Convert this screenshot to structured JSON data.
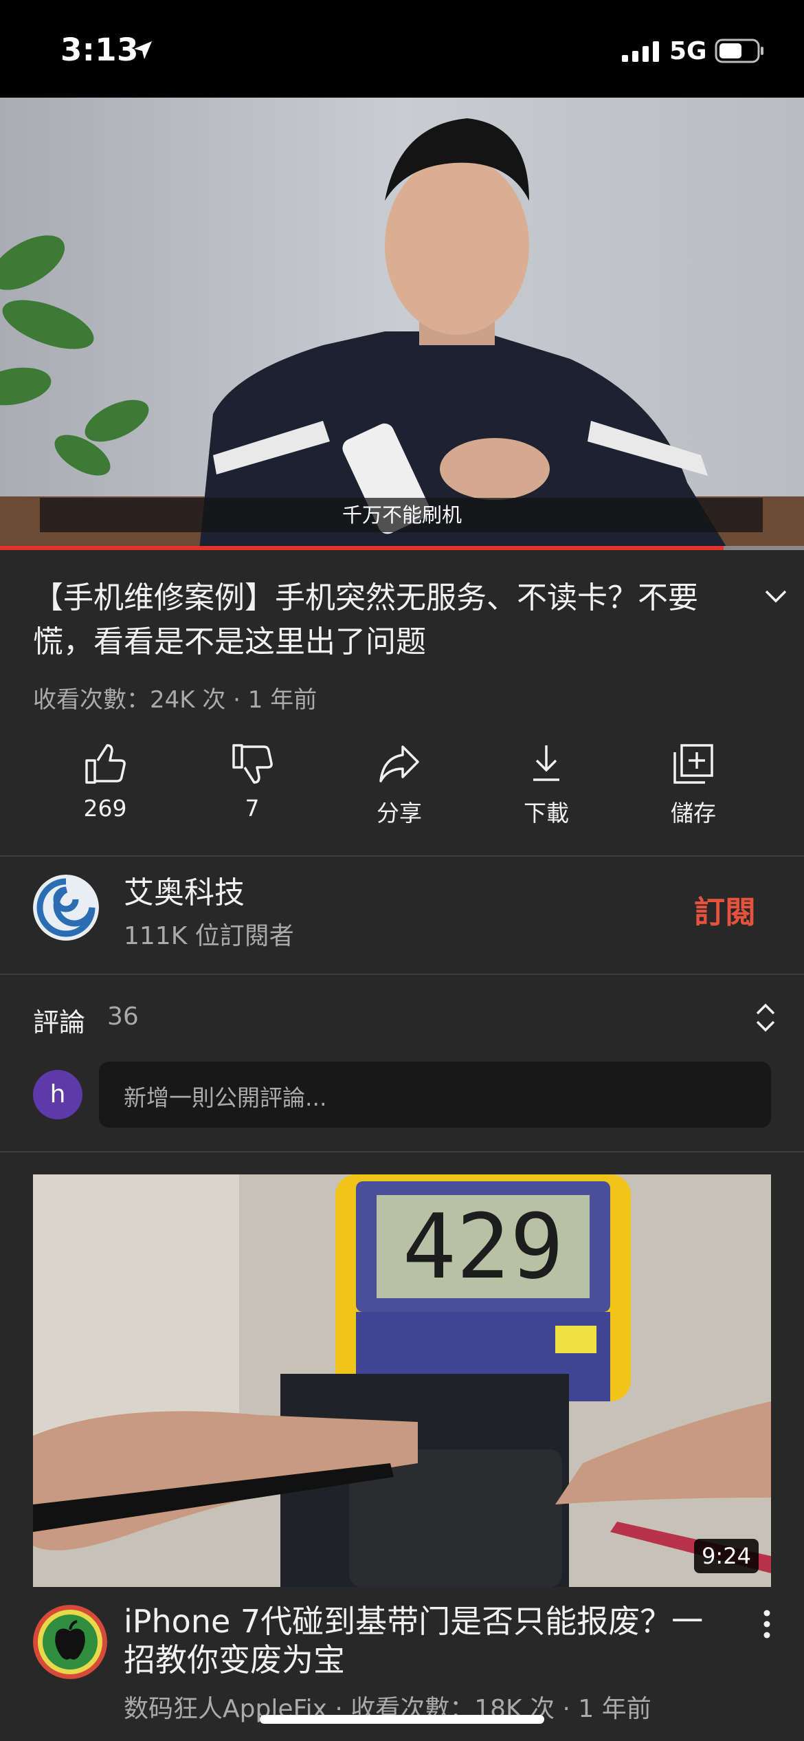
{
  "status_bar": {
    "time": "3:13",
    "network": "5G"
  },
  "video": {
    "caption": "千万不能刷机",
    "progress": 0.9,
    "title": "【手机维修案例】手机突然无服务、不读卡？不要慌，看看是不是这里出了问题",
    "meta": "收看次數：24K 次 · 1 年前"
  },
  "actions": [
    {
      "icon": "thumbs-up-icon",
      "label": "269"
    },
    {
      "icon": "thumbs-down-icon",
      "label": "7"
    },
    {
      "icon": "share-icon",
      "label": "分享"
    },
    {
      "icon": "download-icon",
      "label": "下載"
    },
    {
      "icon": "save-icon",
      "label": "儲存"
    }
  ],
  "channel": {
    "name": "艾奥科技",
    "subscribers": "111K 位訂閱者",
    "subscribe_label": "訂閱"
  },
  "comments": {
    "title": "評論",
    "count": "36",
    "avatar_letter": "h",
    "placeholder": "新增一則公開評論..."
  },
  "next_video": {
    "duration": "9:24",
    "title": "iPhone 7代碰到基带门是否只能报废？一招教你变废为宝",
    "meta": "数码狂人AppleFix · 收看次數：18K 次 · 1 年前",
    "meter_reading": "429"
  },
  "colors": {
    "background": "#282828",
    "accent": "#e5533d",
    "progress": "#e6332a",
    "avatar": "#5c3aa8"
  }
}
